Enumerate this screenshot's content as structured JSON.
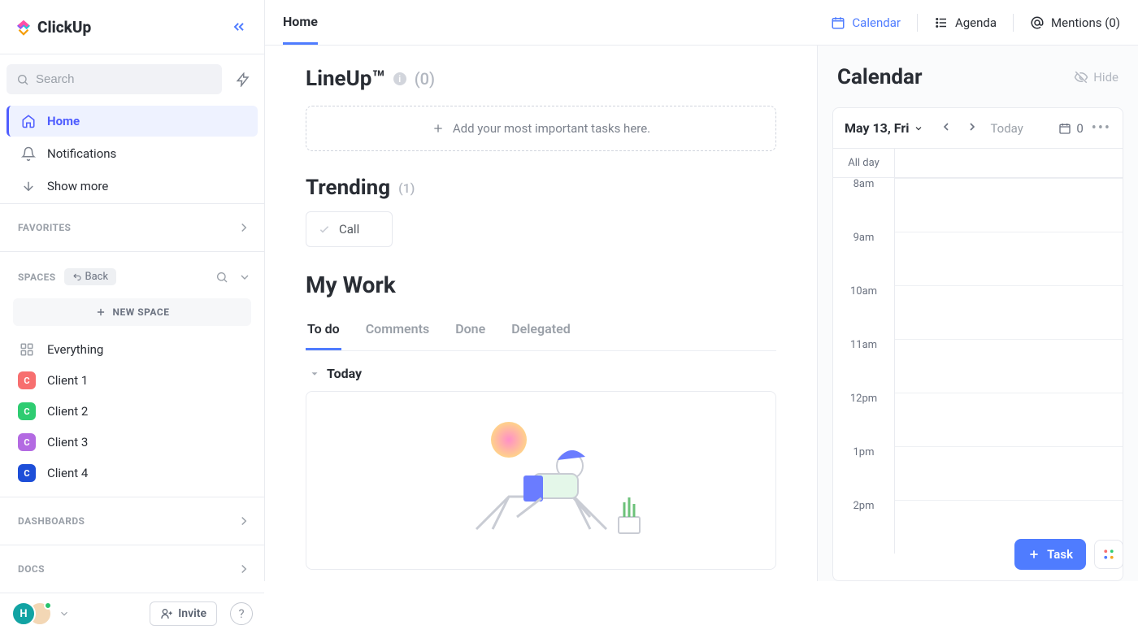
{
  "app": {
    "brand": "ClickUp"
  },
  "sidebar": {
    "search_placeholder": "Search",
    "nav": [
      {
        "label": "Home"
      },
      {
        "label": "Notifications"
      },
      {
        "label": "Show more"
      }
    ],
    "favorites_label": "FAVORITES",
    "spaces_label": "SPACES",
    "back_label": "Back",
    "new_space_label": "NEW SPACE",
    "everything_label": "Everything",
    "spaces": [
      {
        "label": "Client 1",
        "initial": "C",
        "color": "#f76f6f"
      },
      {
        "label": "Client 2",
        "initial": "C",
        "color": "#2ecc71"
      },
      {
        "label": "Client 3",
        "initial": "C",
        "color": "#b36ae2"
      },
      {
        "label": "Client 4",
        "initial": "C",
        "color": "#1d4ed8"
      }
    ],
    "dashboards_label": "DASHBOARDS",
    "docs_label": "DOCS",
    "avatar_initial": "H",
    "invite_label": "Invite"
  },
  "topbar": {
    "title": "Home",
    "calendar": "Calendar",
    "agenda": "Agenda",
    "mentions": "Mentions (0)"
  },
  "lineup": {
    "title": "LineUp™",
    "count": "(0)",
    "placeholder": "Add your most important tasks here."
  },
  "trending": {
    "title": "Trending",
    "count": "(1)",
    "item": "Call"
  },
  "mywork": {
    "title": "My Work",
    "tabs": [
      "To do",
      "Comments",
      "Done",
      "Delegated"
    ],
    "group": "Today"
  },
  "calendar": {
    "title": "Calendar",
    "hide": "Hide",
    "date": "May 13, Fri",
    "today": "Today",
    "count": "0",
    "allday": "All day",
    "hours": [
      "8am",
      "9am",
      "10am",
      "11am",
      "12pm",
      "1pm",
      "2pm"
    ]
  },
  "task_button": "Task"
}
